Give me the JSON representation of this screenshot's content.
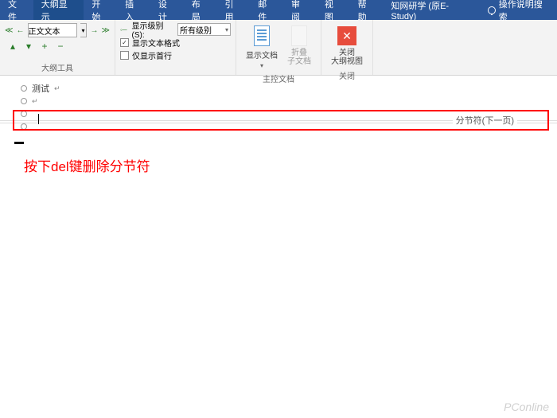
{
  "menubar": {
    "tabs": [
      "文件",
      "大纲显示",
      "开始",
      "插入",
      "设计",
      "布局",
      "引用",
      "邮件",
      "审阅",
      "视图",
      "帮助",
      "知网研学 (原E-Study)"
    ],
    "active_index": 1,
    "tell_me": "操作说明搜索"
  },
  "ribbon": {
    "style_value": "正文文本",
    "outline_tools_label": "大纲工具",
    "show_level_label": "显示级别(S):",
    "show_level_value": "所有级别",
    "show_format": "显示文本格式",
    "show_first_line": "仅显示首行",
    "show_doc": "显示文档",
    "collapse_sub": "折叠\n子文档",
    "master_doc_label": "主控文档",
    "close_btn": "关闭\n大纲视图",
    "close_label": "关闭"
  },
  "document": {
    "test_text": "测试",
    "section_break": "分节符(下一页)"
  },
  "annotation": "按下del键删除分节符",
  "watermark": "PConline"
}
